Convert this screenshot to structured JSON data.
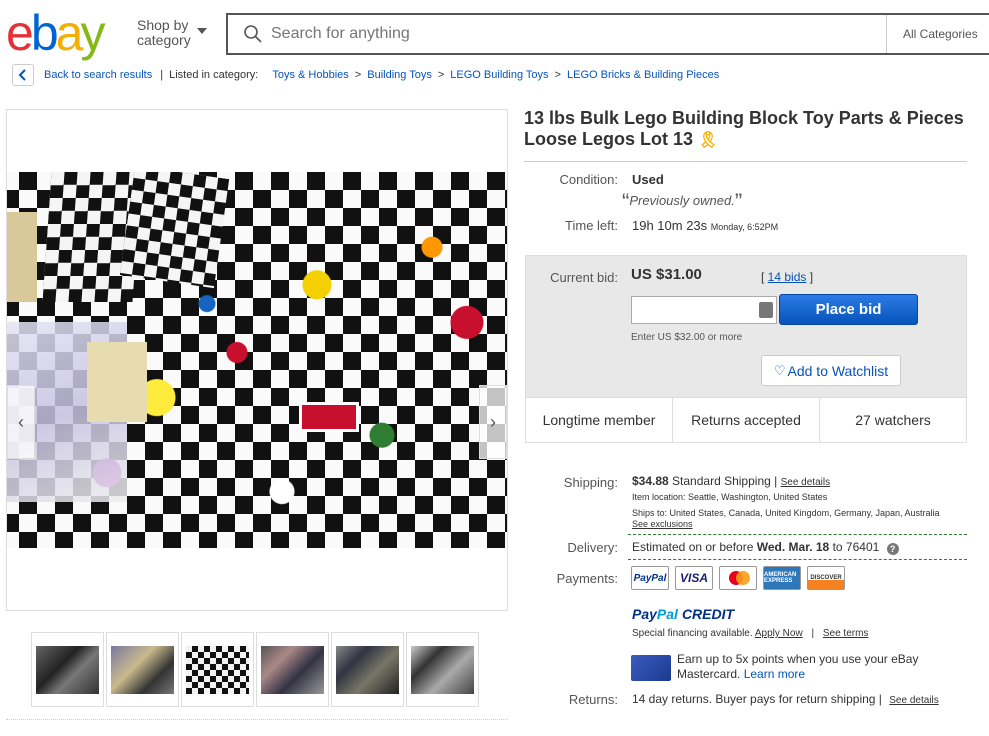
{
  "header": {
    "logo": "ebay",
    "shop_by_line1": "Shop by",
    "shop_by_line2": "category",
    "search_placeholder": "Search for anything",
    "all_categories": "All Categories"
  },
  "breadcrumb": {
    "back": "Back to search results",
    "listed_in": "Listed in category:",
    "items": [
      "Toys & Hobbies",
      "Building Toys",
      "LEGO Building Toys",
      "LEGO Bricks & Building Pieces"
    ],
    "separator": ">"
  },
  "gallery": {
    "prev_arrow": "‹",
    "next_arrow": "›",
    "thumb_count": 6
  },
  "item": {
    "title": "13 lbs Bulk Lego Building Block Toy Parts & Pieces Loose Legos Lot 13",
    "ribbon": "🎗"
  },
  "condition": {
    "label": "Condition:",
    "value": "Used",
    "description": "Previously owned."
  },
  "time_left": {
    "label": "Time left:",
    "value": "19h 10m 23s",
    "end": "Monday, 6:52PM"
  },
  "bid": {
    "label": "Current bid:",
    "value": "US $31.00",
    "bids_open": "[ ",
    "bids_link": "14 bids",
    "bids_close": " ]",
    "place_bid": "Place bid",
    "enter_note": "Enter US $32.00 or more",
    "watchlist": "Add to Watchlist"
  },
  "signals": [
    "Longtime member",
    "Returns accepted",
    "27 watchers"
  ],
  "shipping": {
    "label": "Shipping:",
    "cost": "$34.88",
    "method": "Standard Shipping",
    "bar": "|",
    "details": "See details",
    "location_label": "Item location:",
    "location": "Seattle, Washington, United States",
    "ships_to_label": "Ships to:",
    "ships_to": "United States, Canada, United Kingdom, Germany, Japan, Australia",
    "exclusions": "See exclusions"
  },
  "delivery": {
    "label": "Delivery:",
    "prefix": "Estimated on or before",
    "date": "Wed. Mar. 18",
    "suffix": "to 76401",
    "help": "?"
  },
  "payments": {
    "label": "Payments:",
    "logos": [
      "PayPal",
      "VISA",
      "",
      "AMERICAN EXPRESS",
      "DISCOVER"
    ]
  },
  "paypal_credit": {
    "pay": "Pay",
    "pal": "Pal",
    "credit": "CREDIT",
    "financing": "Special financing available.",
    "apply": "Apply Now",
    "bar": "|",
    "terms": "See terms"
  },
  "mastercard": {
    "line1": "Earn up to 5x points when you use your eBay",
    "line2": "Mastercard.",
    "learn_more": "Learn more"
  },
  "returns": {
    "label": "Returns:",
    "value": "14 day returns. Buyer pays for return shipping |",
    "details": "See details"
  }
}
